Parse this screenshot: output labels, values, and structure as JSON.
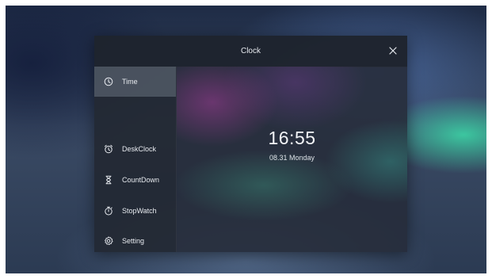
{
  "window": {
    "title": "Clock",
    "close_icon": "close-icon"
  },
  "sidebar": {
    "items": [
      {
        "label": "Time",
        "icon": "clock-icon",
        "active": true
      },
      {
        "label": "DeskClock",
        "icon": "alarm-clock-icon",
        "active": false
      },
      {
        "label": "CountDown",
        "icon": "hourglass-icon",
        "active": false
      },
      {
        "label": "StopWatch",
        "icon": "stopwatch-icon",
        "active": false
      },
      {
        "label": "Setting",
        "icon": "gear-icon",
        "active": false
      }
    ]
  },
  "main": {
    "time": "16:55",
    "date": "08.31 Monday"
  },
  "colors": {
    "text": "#e7eaef",
    "active_item": "#7a8291",
    "accent_glow": "#3cdcaa"
  }
}
